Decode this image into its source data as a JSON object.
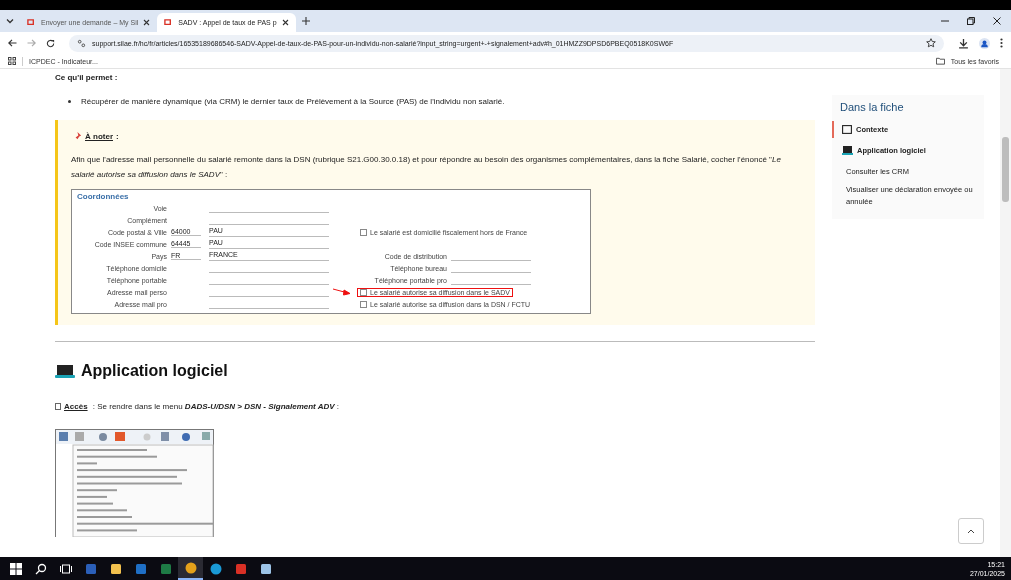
{
  "browser": {
    "tabs": [
      {
        "title": "Envoyer une demande – My Sil",
        "selected": false
      },
      {
        "title": "SADV : Appel de taux de PAS p",
        "selected": true
      }
    ],
    "url": "support.silae.fr/hc/fr/articles/16535189686546-SADV-Appel-de-taux-de-PAS-pour-un-individu-non-salarié?input_string=urgent+-+signalement+adv#h_01HMZZ9DPSD6PBEQ0518K0SW6F",
    "bookmarks": [
      "ICPDEC - Indicateur..."
    ],
    "all_bookmarks": "Tous les favoris"
  },
  "article": {
    "intro_label": "Ce qu'il permet :",
    "bullets": [
      "Récupérer de manière dynamique (via CRM) le dernier taux de Prélèvement à la Source (PAS) de l'individu non salarié."
    ],
    "note": {
      "title": "À noter",
      "title_suffix": " :",
      "text": "Afin que l'adresse mail personnelle du salarié remonte dans la DSN (rubrique S21.G00.30.0.18) et pour répondre au besoin des organismes complémentaires, dans la fiche Salarié, cocher l'énoncé \"*Le salarié autorise sa diffusion dans le SADV*\" :",
      "form": {
        "title": "Coordonnées",
        "rows": [
          {
            "label": "Voie"
          },
          {
            "label": "Complément"
          },
          {
            "label": "Code postal & Ville",
            "code": "64000",
            "value": "PAU",
            "check": {
              "label": "Le salarié est domicilié fiscalement hors de France",
              "checked": false,
              "highlighted": false
            }
          },
          {
            "label": "Code INSEE commune",
            "code": "64445",
            "value": "PAU"
          },
          {
            "label": "Pays",
            "code": "FR",
            "value": "FRANCE",
            "right_label": "Code de distribution"
          },
          {
            "label": "Téléphone domicile",
            "right_label": "Téléphone bureau"
          },
          {
            "label": "Téléphone portable",
            "right_label": "Téléphone portable pro"
          },
          {
            "label": "Adresse mail perso",
            "check": {
              "label": "Le salarié autorise sa diffusion dans le SADV",
              "checked": false,
              "highlighted": true
            }
          },
          {
            "label": "Adresse mail pro",
            "check": {
              "label": "Le salarié autorise sa diffusion dans la DSN / FCTU",
              "checked": false,
              "highlighted": false
            }
          }
        ]
      }
    },
    "heading": "Application logiciel",
    "access": {
      "label": "Accès",
      "text": " : Se rendre dans le menu ",
      "menu_path": "DADS-U/DSN > DSN - Signalement ADV",
      "suffix": " :"
    }
  },
  "toc": {
    "title": "Dans la fiche",
    "items": [
      {
        "label": "Contexte",
        "kind": "square",
        "selected": true
      },
      {
        "label": "Application logiciel",
        "kind": "laptop",
        "selected": false,
        "children": [
          {
            "label": "Consulter les CRM",
            "selected": false
          },
          {
            "label": "Visualiser une déclaration envoyée ou annulée",
            "selected": false
          }
        ]
      }
    ]
  },
  "taskbar": {
    "time": "15:21",
    "date": "27/01/2025"
  }
}
